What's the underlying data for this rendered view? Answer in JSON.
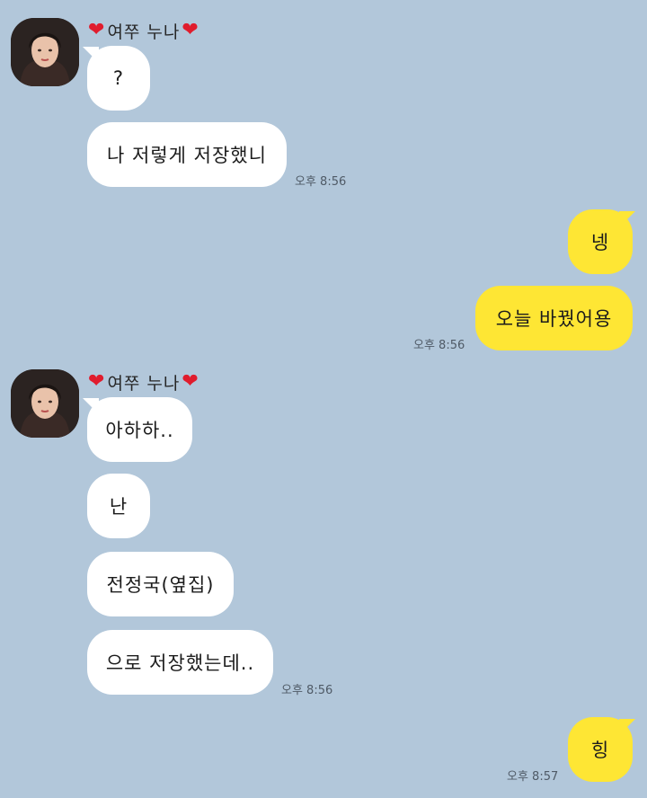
{
  "chat": {
    "sender_name": "여쭈 누나",
    "heart_glyph": "❤",
    "groups": [
      {
        "messages": [
          "?",
          "나 저렇게 저장했니"
        ],
        "time": "오후 8:56"
      },
      {
        "messages": [
          "넹",
          "오늘 바꿨어용"
        ],
        "time": "오후 8:56"
      },
      {
        "messages": [
          "아하하..",
          "난",
          "전정국(옆집)",
          "으로 저장했는데.."
        ],
        "time": "오후 8:56"
      },
      {
        "messages": [
          "힝"
        ],
        "time": "오후 8:57"
      }
    ]
  },
  "colors": {
    "background": "#b2c7da",
    "incoming_bubble": "#ffffff",
    "outgoing_bubble": "#fee634",
    "heart": "#e01c2d"
  }
}
